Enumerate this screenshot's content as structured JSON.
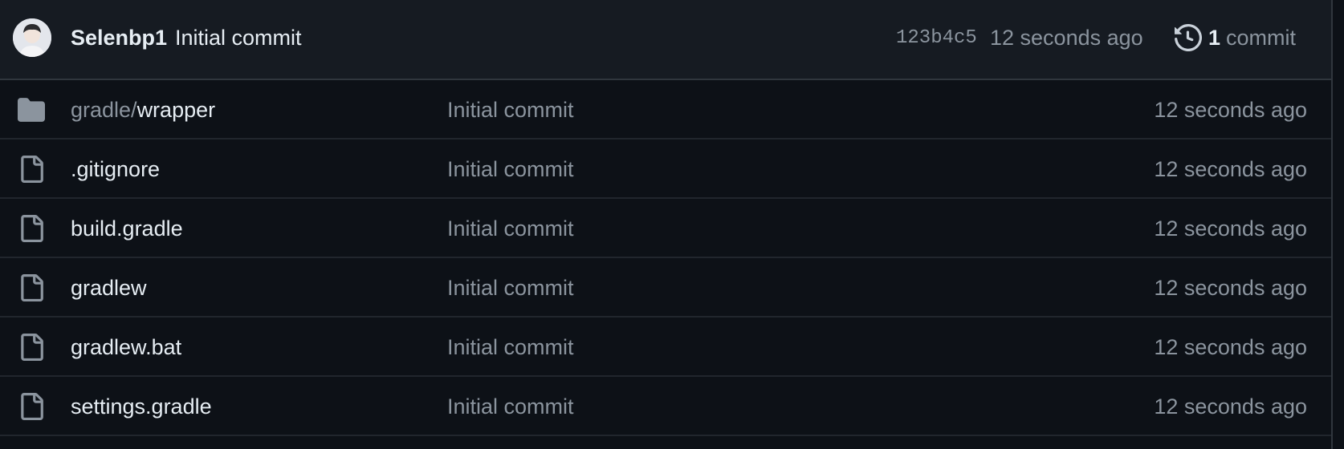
{
  "latest_commit": {
    "author": "Selenbp1",
    "message": "Initial commit",
    "sha": "123b4c5",
    "time": "12 seconds ago",
    "count": "1",
    "count_label": "commit"
  },
  "files": [
    {
      "type": "folder",
      "name_prefix": "gradle/",
      "name": "wrapper",
      "message": "Initial commit",
      "time": "12 seconds ago"
    },
    {
      "type": "file",
      "name_prefix": "",
      "name": ".gitignore",
      "message": "Initial commit",
      "time": "12 seconds ago"
    },
    {
      "type": "file",
      "name_prefix": "",
      "name": "build.gradle",
      "message": "Initial commit",
      "time": "12 seconds ago"
    },
    {
      "type": "file",
      "name_prefix": "",
      "name": "gradlew",
      "message": "Initial commit",
      "time": "12 seconds ago"
    },
    {
      "type": "file",
      "name_prefix": "",
      "name": "gradlew.bat",
      "message": "Initial commit",
      "time": "12 seconds ago"
    },
    {
      "type": "file",
      "name_prefix": "",
      "name": "settings.gradle",
      "message": "Initial commit",
      "time": "12 seconds ago"
    }
  ],
  "icons": {
    "folder": "folder-icon",
    "file": "file-icon",
    "history": "history-icon"
  },
  "colors": {
    "background": "#0d1117",
    "header_background": "#161b22",
    "text_primary": "#e6edf3",
    "text_muted": "#8b949e",
    "border": "#30363d"
  }
}
